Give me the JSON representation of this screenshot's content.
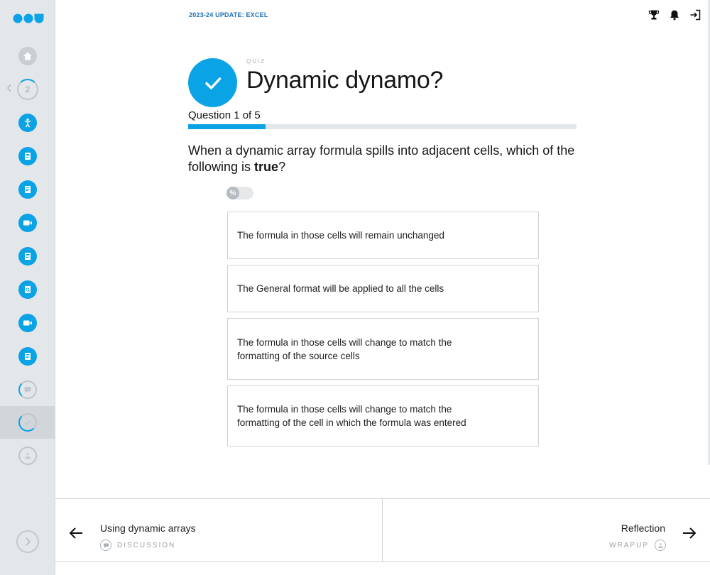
{
  "header": {
    "course_title": "2023-24 UPDATE: EXCEL"
  },
  "sidebar": {
    "module_number": "2",
    "items": [
      {
        "icon": "home-icon"
      },
      {
        "icon": "module-progress-icon"
      },
      {
        "icon": "activity-figure-icon"
      },
      {
        "icon": "document-icon"
      },
      {
        "icon": "document-icon"
      },
      {
        "icon": "video-icon"
      },
      {
        "icon": "document-icon"
      },
      {
        "icon": "search-document-icon"
      },
      {
        "icon": "video-icon"
      },
      {
        "icon": "document-icon"
      },
      {
        "icon": "discussion-icon"
      },
      {
        "icon": "quiz-check-icon"
      },
      {
        "icon": "wrapup-icon"
      }
    ]
  },
  "quiz": {
    "kicker": "QUIZ",
    "title": "Dynamic dynamo?",
    "question_count": "Question 1 of 5",
    "progress_fraction": 0.2,
    "question_main": "When a dynamic array formula spills into adjacent cells, which of the following is ",
    "question_emphasis": "true",
    "question_end": "?",
    "percent_toggle_label": "%",
    "options": [
      "The formula in those cells will remain unchanged",
      "The General format will be applied to all the cells",
      "The formula in those cells will change to match the formatting of the source cells",
      "The formula in those cells will change to match the formatting of the cell in which the formula was entered"
    ]
  },
  "footer": {
    "prev_title": "Using dynamic arrays",
    "prev_type": "DISCUSSION",
    "next_title": "Reflection",
    "next_type": "WRAPUP"
  },
  "colors": {
    "accent": "#0aa3e6",
    "sidebar_bg": "#e3e7ea",
    "course_title": "#1a6fb8"
  }
}
